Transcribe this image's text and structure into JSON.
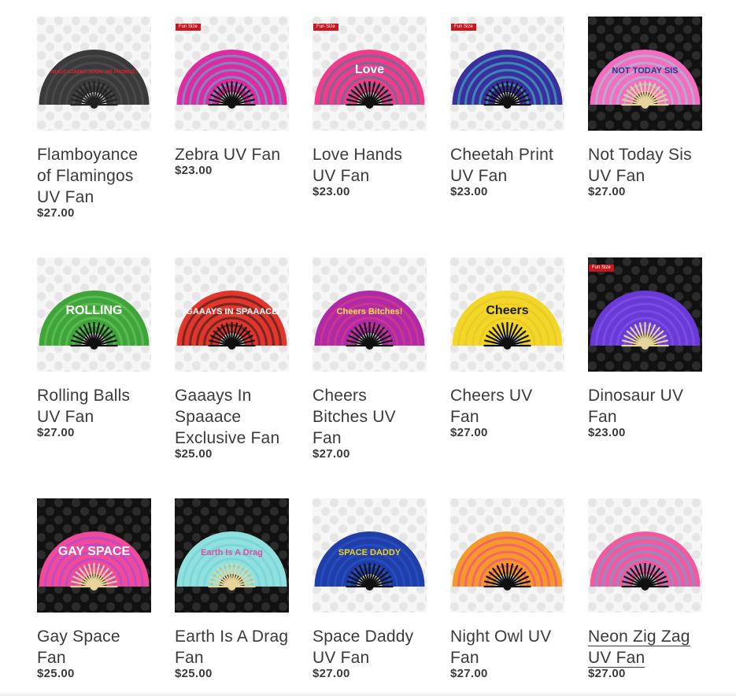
{
  "badge_label": "Fun Size",
  "products": [
    {
      "title": "Flamboyance of Flamingos UV Fan",
      "price": "$27.00",
      "badge": false,
      "bg": "light",
      "fan": "#3a3a3a",
      "fan2": "#555555",
      "handle": "#222222",
      "text": "IMAGE COMING SOON, WE PROMISE!",
      "text_color": "#e0202a"
    },
    {
      "title": "Zebra UV Fan",
      "price": "$23.00",
      "badge": true,
      "bg": "light",
      "fan": "#e02aa0",
      "fan2": "#2fd1e6",
      "handle": "#111111",
      "text": "",
      "text_color": "#ffffff"
    },
    {
      "title": "Love Hands UV Fan",
      "price": "$23.00",
      "badge": true,
      "bg": "light",
      "fan": "#f23b8a",
      "fan2": "#1a8d9a",
      "handle": "#111111",
      "text": "Love",
      "text_color": "#ffffff"
    },
    {
      "title": "Cheetah Print UV Fan",
      "price": "$23.00",
      "badge": true,
      "bg": "light",
      "fan": "#3a2f9e",
      "fan2": "#3fd0c8",
      "handle": "#111111",
      "text": "",
      "text_color": "#ffffff"
    },
    {
      "title": "Not Today Sis UV Fan",
      "price": "$27.00",
      "badge": false,
      "bg": "dark",
      "fan": "#f56cc0",
      "fan2": "#7fe0d6",
      "handle": "#e6d49a",
      "text": "NOT TODAY SIS",
      "text_color": "#1e3c8a"
    },
    {
      "title": "Rolling Balls UV Fan",
      "price": "$27.00",
      "badge": false,
      "bg": "light",
      "fan": "#3fa53a",
      "fan2": "#6fd064",
      "handle": "#111111",
      "text": "ROLLING",
      "text_color": "#ffffff"
    },
    {
      "title": "Gaaays In Spaaace Exclusive Fan",
      "price": "$25.00",
      "badge": false,
      "bg": "light",
      "fan": "#e2352b",
      "fan2": "#1b1b1b",
      "handle": "#111111",
      "text": "GAAAYS IN SPAAACE",
      "text_color": "#ffffff"
    },
    {
      "title": "Cheers Bitches UV Fan",
      "price": "$27.00",
      "badge": false,
      "bg": "light",
      "fan": "#b02aa8",
      "fan2": "#e0407a",
      "handle": "#111111",
      "text": "Cheers Bitches!",
      "text_color": "#f3e24a"
    },
    {
      "title": "Cheers UV Fan",
      "price": "$27.00",
      "badge": false,
      "bg": "light",
      "fan": "#f2d72a",
      "fan2": "#e8c21c",
      "handle": "#111111",
      "text": "Cheers",
      "text_color": "#1b1b1b"
    },
    {
      "title": "Dinosaur UV Fan",
      "price": "$23.00",
      "badge": true,
      "bg": "dark",
      "fan": "#6a3ad6",
      "fan2": "#8a5af0",
      "handle": "#e6d49a",
      "text": "",
      "text_color": "#ffffff"
    },
    {
      "title": "Gay Space Fan",
      "price": "$25.00",
      "badge": false,
      "bg": "dark",
      "fan": "#f04a9a",
      "fan2": "#9a4ae0",
      "handle": "#e6d49a",
      "text": "GAY SPACE",
      "text_color": "#ffffff"
    },
    {
      "title": "Earth Is A Drag Fan",
      "price": "$25.00",
      "badge": false,
      "bg": "dark",
      "fan": "#8fe0df",
      "fan2": "#6ccfcf",
      "handle": "#e6d49a",
      "text": "Earth Is A Drag",
      "text_color": "#e04aa0"
    },
    {
      "title": "Space Daddy UV Fan",
      "price": "$27.00",
      "badge": false,
      "bg": "light",
      "fan": "#1f3ea8",
      "fan2": "#2b58d6",
      "handle": "#111111",
      "text": "SPACE DADDY",
      "text_color": "#f2d21a"
    },
    {
      "title": "Night Owl UV Fan",
      "price": "$27.00",
      "badge": false,
      "bg": "light",
      "fan": "#f59a2a",
      "fan2": "#f03a9a",
      "handle": "#111111",
      "text": "",
      "text_color": "#ffffff"
    },
    {
      "title": "Neon Zig Zag UV Fan",
      "price": "$27.00",
      "badge": false,
      "bg": "light",
      "fan": "#f25aa0",
      "fan2": "#3ab8e0",
      "handle": "#111111",
      "text": "",
      "text_color": "#ffffff",
      "hovered": true
    }
  ]
}
